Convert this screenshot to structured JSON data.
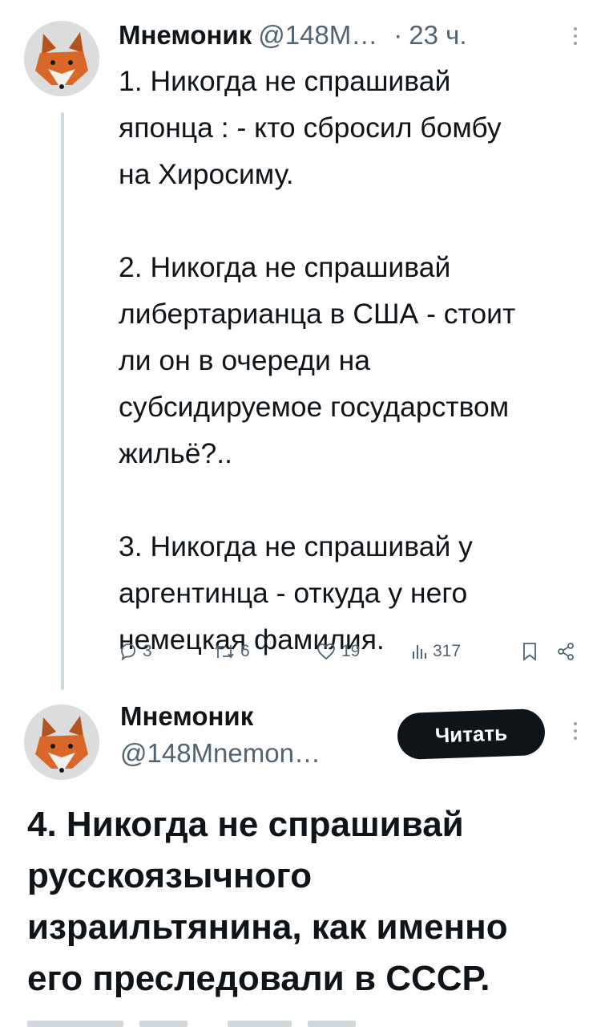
{
  "tweet1": {
    "author_name": "Мнемоник",
    "handle": "@148M…",
    "separator": "·",
    "time": "23 ч.",
    "text": "1. Никогда не спрашивай\nяпонца : - кто сбросил бомбу\nна Хиросиму.\n\n2. Никогда не спрашивай\nлибертарианца в США - стоит\nли он в очереди на\nсубсидируемое государством\nжильё?..\n\n3. Никогда не спрашивай у\nаргентинца - откуда у него\nнемецкая фамилия.",
    "actions": {
      "replies": "3",
      "retweets": "6",
      "likes": "19",
      "views": "317"
    },
    "icons": [
      "reply-icon",
      "retweet-icon",
      "like-icon",
      "views-icon",
      "bookmark-icon",
      "share-icon",
      "more-icon"
    ]
  },
  "tweet2": {
    "author_name": "Мнемоник",
    "handle": "@148Mnemon…",
    "follow_label": "Читать",
    "text": "4. Никогда не спрашивай\nрусскоязычного\nизраильтянина, как именно\nего преследовали в СССР."
  },
  "colors": {
    "text": "#0f1419",
    "muted": "#536471",
    "thread_line": "#cfd9de",
    "button_bg": "#0f1419"
  }
}
